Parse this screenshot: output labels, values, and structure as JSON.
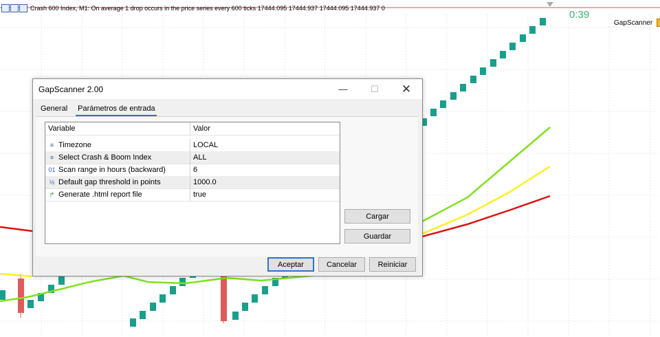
{
  "chart": {
    "header_text": "Crash 600 Index, M1:  On average 1 drop occurs in the price series every 600 ticks  17444.095 17444.937 17444.095 17444.937  0",
    "countdown": "0:39",
    "indicator_label": "GapScanner",
    "colors": {
      "bull_candle": "#199f8b",
      "bear_candle": "#e15a5a",
      "ma_red": "#dd1111",
      "ma_yellow": "#ffee22",
      "ma_green": "#7fe21b"
    }
  },
  "dialog": {
    "title": "GapScanner 2.00",
    "minimize_icon": "minimize-icon",
    "maximize_icon": "maximize-icon",
    "close_icon": "close-icon",
    "tabs": [
      {
        "label": "General",
        "active": false
      },
      {
        "label": "Parámetros de entrada",
        "active": true
      }
    ],
    "grid": {
      "headers": {
        "variable": "Variable",
        "value": "Valor"
      },
      "rows": [
        {
          "icon": "list-icon",
          "variable": "Timezone",
          "value": "LOCAL"
        },
        {
          "icon": "list-icon",
          "variable": "Select Crash & Boom Index",
          "value": "ALL"
        },
        {
          "icon": "integer-icon",
          "variable": "Scan range in hours (backward)",
          "value": "6"
        },
        {
          "icon": "fraction-icon",
          "variable": "Default gap threshold in points",
          "value": "1000.0"
        },
        {
          "icon": "bool-icon",
          "variable": "Generate .html report file",
          "value": "true"
        }
      ]
    },
    "buttons": {
      "load": "Cargar",
      "save": "Guardar",
      "accept": "Aceptar",
      "cancel": "Cancelar",
      "reset": "Reiniciar"
    }
  }
}
